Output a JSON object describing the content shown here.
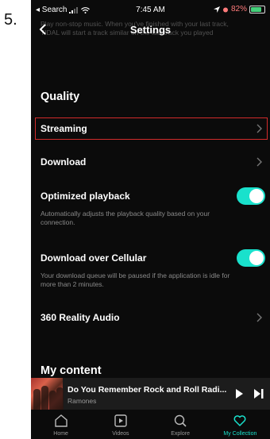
{
  "step_number": "5.",
  "status_bar": {
    "back_app": "◂ Search",
    "time": "7:45 AM",
    "battery": "82%",
    "battery_level": 0.82
  },
  "nav": {
    "title": "Settings",
    "faded_text": "Play non-stop music. When you've finished with your last track, TIDAL will start a track similar on the last track you played"
  },
  "quality": {
    "title": "Quality",
    "streaming_label": "Streaming",
    "download_label": "Download",
    "optimized_label": "Optimized playback",
    "optimized_desc": "Automatically adjusts the playback quality based on your connection.",
    "optimized_on": true,
    "cellular_label": "Download over Cellular",
    "cellular_desc": "Your download queue will be paused if the application is idle for more than 2 minutes.",
    "cellular_on": true,
    "reality_label": "360 Reality Audio"
  },
  "my_content": {
    "title": "My content"
  },
  "player": {
    "title": "Do You Remember Rock and Roll Radi...",
    "artist": "Ramones"
  },
  "tabs": [
    {
      "label": "Home",
      "icon": "home-icon"
    },
    {
      "label": "Videos",
      "icon": "video-icon"
    },
    {
      "label": "Explore",
      "icon": "search-icon"
    },
    {
      "label": "My Collection",
      "icon": "heart-icon"
    }
  ],
  "colors": {
    "accent": "#19e1cc",
    "highlight": "#d22b2b",
    "background": "#0b0b0b"
  }
}
